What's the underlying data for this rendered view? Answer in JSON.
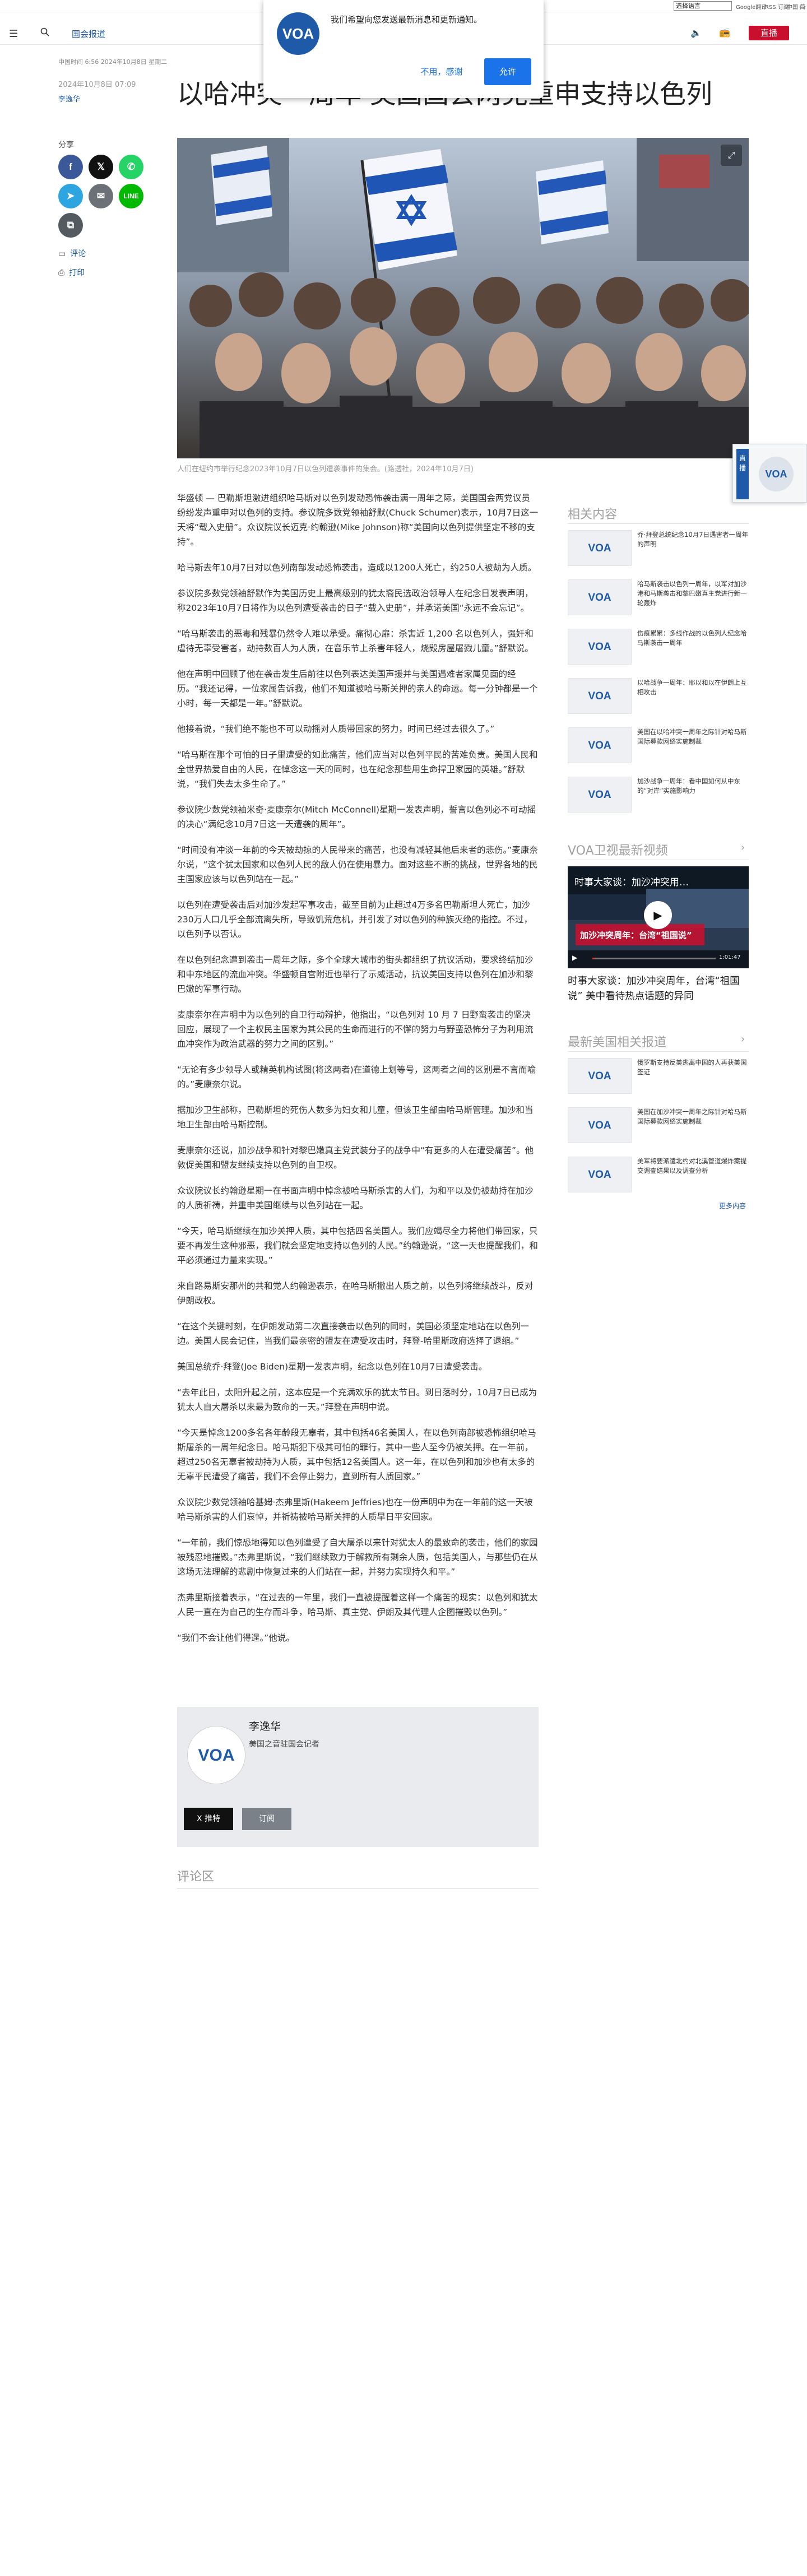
{
  "top": {
    "language": "选择语言",
    "mini_links": [
      "Google翻译",
      "RSS 订阅",
      "中国 简化版"
    ]
  },
  "nav": {
    "section": "国会报道",
    "live": "直播"
  },
  "popup": {
    "logo": "VOA",
    "text": "我们希望向您发送最新消息和更新通知。",
    "deny": "不用，感谢",
    "allow": "允许"
  },
  "article": {
    "meta_line": "中国时间 6:56 2024年10月8日 星期二",
    "date": "2024年10月8日 07:09",
    "author_link": "李逸华",
    "headline": "以哈冲突一周年 美国国会两党重申支持以色列",
    "share": "分享",
    "comment_link": "评论",
    "print_link": "打印",
    "caption": "人们在纽约市举行纪念2023年10月7日以色列遭袭事件的集会。(路透社，2024年10月7日)",
    "paragraphs": [
      "华盛顿 — 巴勒斯坦激进组织哈马斯对以色列发动恐怖袭击满一周年之际，美国国会两党议员纷纷发声重申对以色列的支持。参议院多数党领袖舒默(Chuck Schumer)表示，10月7日这一天将“载入史册”。众议院议长迈克·约翰逊(Mike Johnson)称“美国向以色列提供坚定不移的支持”。",
      "哈马斯去年10月7日对以色列南部发动恐怖袭击，造成以1200人死亡，约250人被劫为人质。",
      "参议院多数党领袖舒默作为美国历史上最高级别的犹太裔民选政治领导人在纪念日发表声明，称2023年10月7日将作为以色列遭受袭击的日子“载入史册”，并承诺美国“永远不会忘记”。",
      "“哈马斯袭击的恶毒和残暴仍然令人难以承受。痛彻心扉：杀害近 1,200 名以色列人，强奸和虐待无辜受害者，劫持数百人为人质，在音乐节上杀害年轻人，烧毁房屋屠戮儿童。”舒默说。",
      "他在声明中回顾了他在袭击发生后前往以色列表达美国声援并与美国遇难者家属见面的经历。“我还记得，一位家属告诉我，他们不知道被哈马斯关押的亲人的命运。每一分钟都是一个小时，每一天都是一年。”舒默说。",
      "他接着说，“我们绝不能也不可以动摇对人质带回家的努力，时间已经过去很久了。”",
      "“哈马斯在那个可怕的日子里遭受的如此痛苦，他们应当对以色列平民的苦难负责。美国人民和全世界热爱自由的人民，在悼念这一天的同时，也在纪念那些用生命捍卫家园的英雄。”舒默说，“我们失去太多生命了。”",
      "参议院少数党领袖米奇·麦康奈尔(Mitch McConnell)星期一发表声明，誓言以色列必不可动摇的决心“满纪念10月7日这一天遭袭的周年”。",
      "“时间没有冲淡一年前的今天被劫掠的人民带来的痛苦，也没有减轻其他后来者的悲伤。”麦康奈尔说，“这个犹太国家和以色列人民的敌人仍在使用暴力。面对这些不断的挑战，世界各地的民主国家应该与以色列站在一起。”",
      "以色列在遭受袭击后对加沙发起军事攻击，截至目前为止超过4万多名巴勒斯坦人死亡，加沙230万人口几乎全部流离失所，导致饥荒危机，并引发了对以色列的种族灭绝的指控。不过，以色列予以否认。",
      "在以色列纪念遭到袭击一周年之际，多个全球大城市的街头都组织了抗议活动，要求终结加沙和中东地区的流血冲突。华盛顿自宫附近也举行了示威活动，抗议美国支持以色列在加沙和黎巴嫩的军事行动。",
      "麦康奈尔在声明中为以色列的自卫行动辩护，他指出，“以色列对 10 月 7 日野蛮袭击的坚决回应，展现了一个主权民主国家为其公民的生命而进行的不懈的努力与野蛮恐怖分子为利用流血冲突作为政治武器的努力之间的区别。”",
      "“无论有多少领导人或精英机构试图(将这两者)在道德上划等号，这两者之间的区别是不言而喻的。”麦康奈尔说。",
      "据加沙卫生部称，巴勒斯坦的死伤人数多为妇女和儿童，但该卫生部由哈马斯管理。加沙和当地卫生部由哈马斯控制。",
      "麦康奈尔还说，加沙战争和针对黎巴嫩真主党武装分子的战争中“有更多的人在遭受痛苦”。他敦促美国和盟友继续支持以色列的自卫权。",
      "众议院议长约翰逊星期一在书面声明中悼念被哈马斯杀害的人们，为和平以及仍被劫持在加沙的人质祈祷，并重申美国继续与以色列站在一起。",
      "“今天，哈马斯继续在加沙关押人质，其中包括四名美国人。我们应竭尽全力将他们带回家，只要不再发生这种邪恶，我们就会坚定地支持以色列的人民。”约翰逊说，“这一天也提醒我们，和平必须通过力量来实现。”",
      "来自路易斯安那州的共和党人约翰逊表示，在哈马斯撤出人质之前，以色列将继续战斗，反对伊朗政权。",
      "“在这个关键时刻，在伊朗发动第二次直接袭击以色列的同时，美国必须坚定地站在以色列一边。美国人民会记住，当我们最亲密的盟友在遭受攻击时，拜登-哈里斯政府选择了退缩。”",
      "美国总统乔·拜登(Joe Biden)星期一发表声明，纪念以色列在10月7日遭受袭击。",
      "“去年此日，太阳升起之前，这本应是一个充满欢乐的犹太节日。到日落时分，10月7日已成为犹太人自大屠杀以来最为致命的一天。”拜登在声明中说。",
      "“今天是悼念1200多名各年龄段无辜者，其中包括46名美国人，在以色列南部被恐怖组织哈马斯屠杀的一周年纪念日。哈马斯犯下极其可怕的罪行，其中一些人至今仍被关押。在一年前，超过250名无辜者被劫持为人质，其中包括12名美国人。这一年，在以色列和加沙也有太多的无辜平民遭受了痛苦，我们不会停止努力，直到所有人质回家。”",
      "众议院少数党领袖哈基姆·杰弗里斯(Hakeem Jeffries)也在一份声明中为在一年前的这一天被哈马斯杀害的人们哀悼，并祈祷被哈马斯关押的人质早日平安回家。",
      "“一年前，我们惊恐地得知以色列遭受了自大屠杀以来针对犹太人的最致命的袭击，他们的家园被残忍地摧毁。”杰弗里斯说，“我们继续致力于解救所有剩余人质，包括美国人，与那些仍在从这场无法理解的悲剧中恢复过来的人们站在一起，并努力实现持久和平。”",
      "杰弗里斯接着表示，“在过去的一年里，我们一直被提醒着这样一个痛苦的现实：以色列和犹太人民一直在为自己的生存而斗争，哈马斯、真主党、伊朗及其代理人企图摧毁以色列。”",
      "“我们不会让他们得逞。”他说。"
    ],
    "author_box": {
      "avatar": "VOA",
      "name": "李逸华",
      "role": "美国之音驻国会记者",
      "x_label": "X 推特",
      "subscribe_label": "订阅"
    },
    "comments": "评论区"
  },
  "sidebar": {
    "related_title": "相关内容",
    "related": [
      "乔·拜登总统纪念10月7日遇害者一周年的声明",
      "哈马斯袭击以色列一周年，以军对加沙港和马斯袭击和黎巴嫩真主党进行新一轮轰炸",
      "伤痕累累：多线作战的以色列人纪念哈马斯袭击一周年",
      "以哈战争一周年：耶以和以在伊朗上互相攻击",
      "美国在以哈冲突一周年之际针对哈马斯国际募款网络实施制裁",
      "加沙战争一周年：看中国如何从中东的“对岸”实施影响力"
    ],
    "video_section_title": "VOA卫视最新视频",
    "video_overlay": "时事大家谈：加沙冲突用…",
    "video_badge": "加沙冲突周年：台湾“祖国说”",
    "video_time": "1:01:47",
    "video_title": "时事大家谈：加沙冲突周年，台湾“祖国说” 美中看待热点话题的异同",
    "latest_title": "最新美国相关报道",
    "latest": [
      "俄罗斯支持反美逃离中国的人再获美国签证",
      "美国在加沙冲突一周年之际针对哈马斯国际募款网络实施制裁",
      "美军将要派遣北约对北溪管道爆炸案提交调查结果以及调查分析"
    ],
    "more": "更多内容"
  },
  "float": {
    "logo": "VOA",
    "tab": "直播"
  },
  "colors": {
    "brand": "#1e5aa8",
    "live": "#c8102e",
    "facebook": "#3b5998",
    "whatsapp": "#25d366",
    "telegram": "#2ca5e0",
    "email": "#6b7177",
    "line": "#00b900",
    "copy": "#535a60"
  },
  "icons": [
    "menu-icon",
    "search-icon",
    "speaker-icon",
    "radio-icon",
    "facebook-icon",
    "x-icon",
    "whatsapp-icon",
    "telegram-icon",
    "email-icon",
    "line-icon",
    "copy-link-icon",
    "comment-icon",
    "print-icon",
    "expand-icon",
    "play-icon"
  ]
}
